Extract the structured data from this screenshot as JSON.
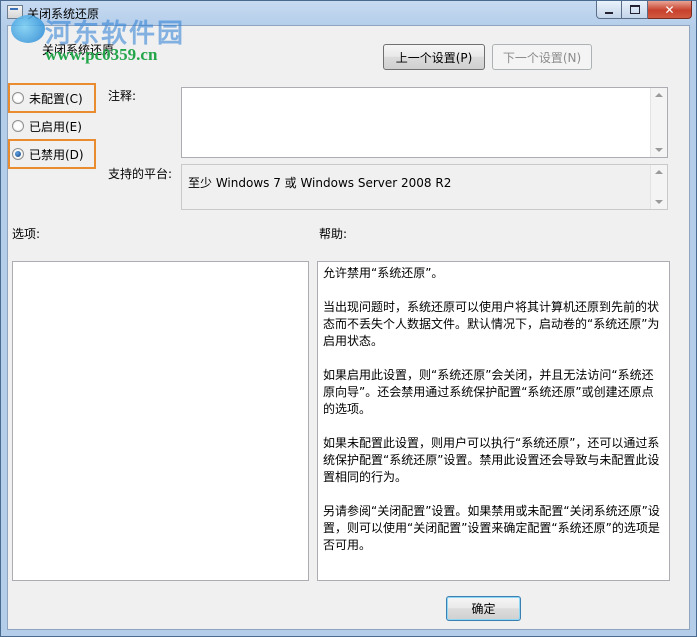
{
  "window": {
    "title": "关闭系统还原",
    "watermark_title": "河东软件园",
    "watermark_url": "www.pc0359.cn"
  },
  "header": {
    "setting_title": "关闭系统还原",
    "prev_button": "上一个设置(P)",
    "next_button": "下一个设置(N)"
  },
  "state": {
    "options": [
      {
        "label": "未配置(C)",
        "checked": false
      },
      {
        "label": "已启用(E)",
        "checked": false
      },
      {
        "label": "已禁用(D)",
        "checked": true
      }
    ]
  },
  "comment": {
    "label": "注释:",
    "value": ""
  },
  "platform": {
    "label": "支持的平台:",
    "value": "至少 Windows 7 或 Windows Server 2008 R2"
  },
  "options_section": {
    "label": "选项:"
  },
  "help": {
    "label": "帮助:",
    "paragraphs": [
      "允许禁用“系统还原”。",
      "当出现问题时，系统还原可以使用户将其计算机还原到先前的状态而不丢失个人数据文件。默认情况下，启动卷的“系统还原”为启用状态。",
      "如果启用此设置，则“系统还原”会关闭，并且无法访问“系统还原向导”。还会禁用通过系统保护配置“系统还原”或创建还原点的选项。",
      "如果未配置此设置，则用户可以执行“系统还原”，还可以通过系统保护配置“系统还原”设置。禁用此设置还会导致与未配置此设置相同的行为。",
      "另请参阅“关闭配置”设置。如果禁用或未配置“关闭系统还原”设置，则可以使用“关闭配置”设置来确定配置“系统还原”的选项是否可用。"
    ]
  },
  "footer": {
    "ok_button": "确定"
  },
  "colors": {
    "highlight": "#e88c2f",
    "accent": "#3b6fb6"
  }
}
